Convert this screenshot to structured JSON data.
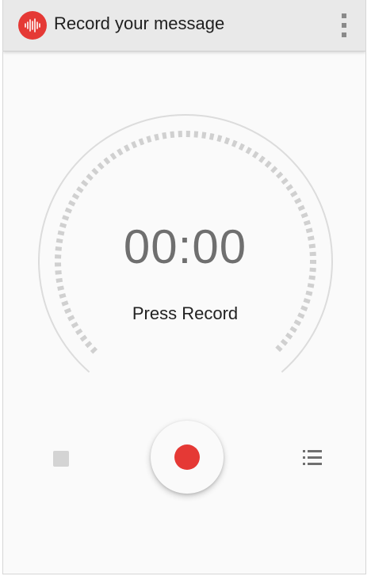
{
  "app_bar": {
    "title": "Record your message",
    "icon": "waveform-icon",
    "menu_icon": "more-vert-icon",
    "accent_color": "#e53935"
  },
  "timer": {
    "elapsed": "00:00",
    "status": "Press Record"
  },
  "controls": {
    "stop_icon": "stop-icon",
    "record_icon": "record-icon",
    "list_icon": "list-icon",
    "record_color": "#e53935"
  }
}
